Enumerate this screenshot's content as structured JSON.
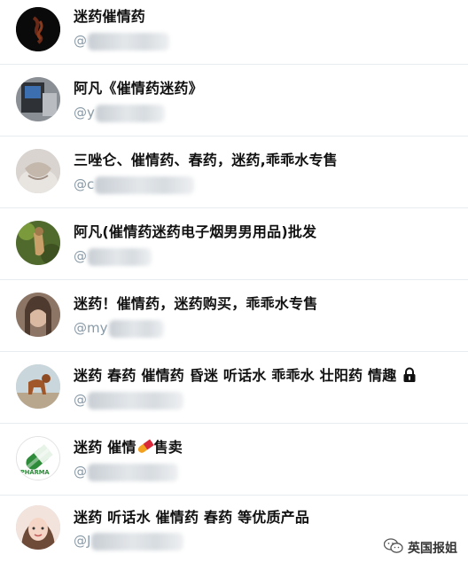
{
  "accounts": [
    {
      "name": "迷药催情药",
      "handle_prefix": "@"
    },
    {
      "name": "阿凡《催情药迷药》",
      "handle_prefix": "@y"
    },
    {
      "name": "三唑仑、催情药、春药，迷药,乖乖水专售",
      "handle_prefix": "@c"
    },
    {
      "name": "阿凡(催情药迷药电子烟男男用品)批发",
      "handle_prefix": "@"
    },
    {
      "name": "迷药！催情药，迷药购买，乖乖水专售",
      "handle_prefix": "@my"
    },
    {
      "name": "迷药 春药 催情药 昏迷 听话水 乖乖水 壮阳药 情趣",
      "handle_prefix": "@"
    },
    {
      "name_start": "迷药 催情",
      "name_end": "售卖",
      "handle_prefix": "@"
    },
    {
      "name": "迷药 听话水 催情药 春药 等优质产品",
      "handle_prefix": "@J"
    }
  ],
  "watermark": {
    "text": "英国报姐",
    "icon": "wechat-icon"
  },
  "icons": {
    "lock": "lock-icon",
    "pill": "pill-icon"
  }
}
